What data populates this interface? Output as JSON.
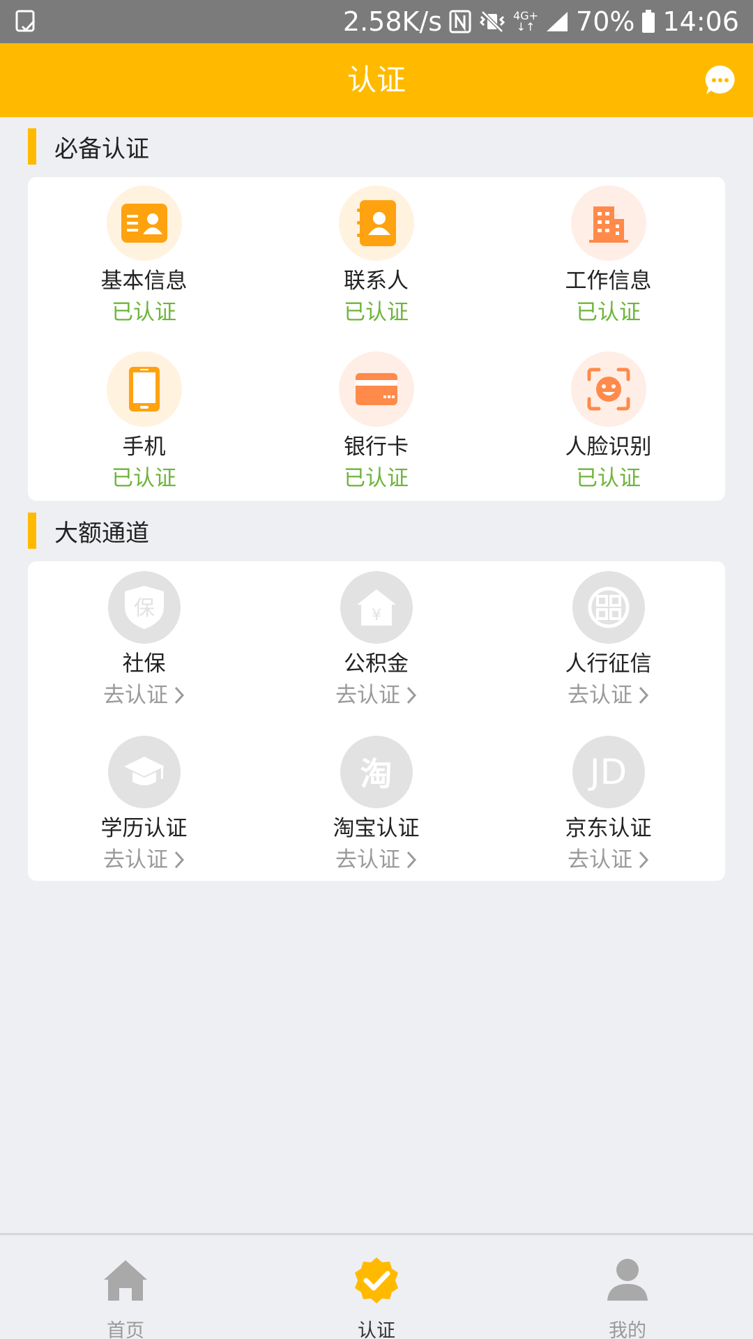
{
  "status_bar": {
    "speed": "2.58K/s",
    "network": "4G+",
    "battery": "70%",
    "time": "14:06"
  },
  "header": {
    "title": "认证"
  },
  "sections": {
    "required": {
      "title": "必备认证",
      "items": [
        {
          "label": "基本信息",
          "status": "已认证",
          "icon": "id-card-icon"
        },
        {
          "label": "联系人",
          "status": "已认证",
          "icon": "contacts-book-icon"
        },
        {
          "label": "工作信息",
          "status": "已认证",
          "icon": "building-icon"
        },
        {
          "label": "手机",
          "status": "已认证",
          "icon": "phone-icon"
        },
        {
          "label": "银行卡",
          "status": "已认证",
          "icon": "bank-card-icon"
        },
        {
          "label": "人脸识别",
          "status": "已认证",
          "icon": "face-scan-icon"
        }
      ]
    },
    "large": {
      "title": "大额通道",
      "items": [
        {
          "label": "社保",
          "status": "去认证",
          "icon": "social-security-icon",
          "glyph": "保"
        },
        {
          "label": "公积金",
          "status": "去认证",
          "icon": "housing-fund-icon",
          "glyph": "¥"
        },
        {
          "label": "人行征信",
          "status": "去认证",
          "icon": "credit-bank-icon"
        },
        {
          "label": "学历认证",
          "status": "去认证",
          "icon": "graduation-cap-icon"
        },
        {
          "label": "淘宝认证",
          "status": "去认证",
          "icon": "taobao-icon",
          "glyph": "淘"
        },
        {
          "label": "京东认证",
          "status": "去认证",
          "icon": "jd-icon",
          "glyph": "JD"
        }
      ]
    }
  },
  "bottom_nav": [
    {
      "label": "首页",
      "icon": "home-icon",
      "active": false
    },
    {
      "label": "认证",
      "icon": "verified-badge-icon",
      "active": true
    },
    {
      "label": "我的",
      "icon": "user-icon",
      "active": false
    }
  ],
  "colors": {
    "accent": "#ffba00",
    "verified": "#6db53a",
    "pending": "#9a9a9a",
    "nav_inactive": "#999999",
    "nav_active": "#333333"
  }
}
